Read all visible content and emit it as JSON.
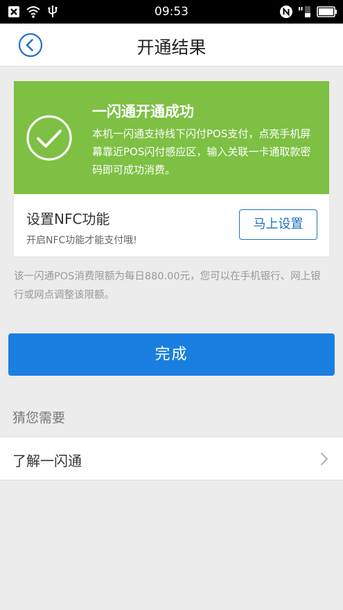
{
  "status_bar": {
    "time": "09:53",
    "icons": [
      "close-box-icon",
      "wifi-icon",
      "usb-icon",
      "nfc-icon",
      "signal-icon",
      "battery-icon"
    ]
  },
  "header": {
    "title": "开通结果",
    "back_icon": "back-circle-icon"
  },
  "success": {
    "title": "一闪通开通成功",
    "description": "本机一闪通支持线下闪付POS支付，点亮手机屏幕靠近POS闪付感应区，输入关联一卡通取款密码即可成功消费。",
    "icon": "check-circle-icon",
    "color": "#7dc043"
  },
  "nfc": {
    "title": "设置NFC功能",
    "subtitle": "开启NFC功能才能支付哦!",
    "button_label": "马上设置"
  },
  "limit_note": "该一闪通POS消费限额为每日880.00元，您可以在手机银行、网上银行或网点调整该限额。",
  "done_button": {
    "label": "完成",
    "color": "#1a7fe0"
  },
  "guess": {
    "label": "猜您需要",
    "items": [
      {
        "label": "了解一闪通",
        "icon": "chevron-right-icon"
      }
    ]
  }
}
